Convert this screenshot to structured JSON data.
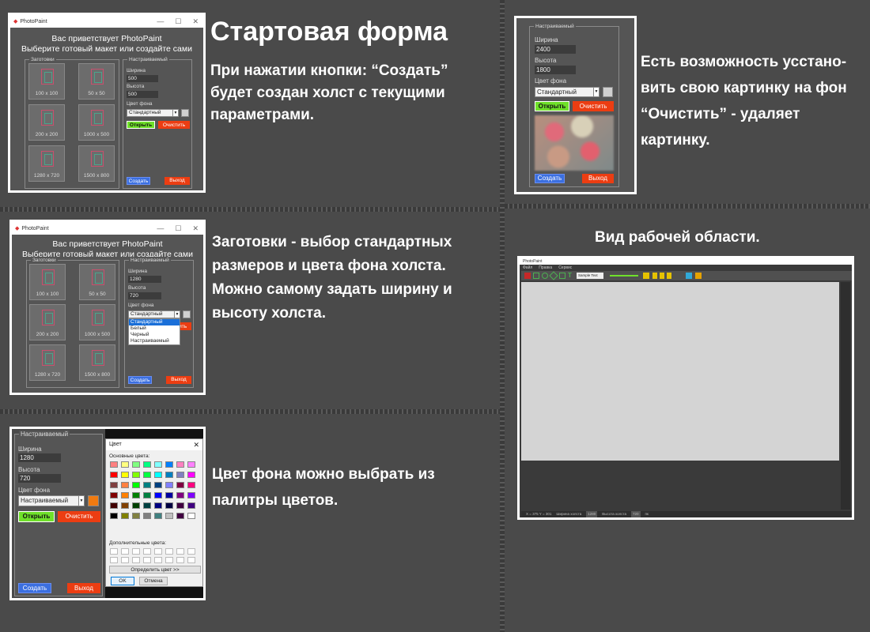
{
  "separators": true,
  "captions": {
    "start_title": "Стартовая форма",
    "start_text": [
      "При нажатии кнопки: “Создать”",
      "будет создан холст с текущими",
      "параметрами."
    ],
    "image_text": [
      "Есть возможность усстано-",
      "вить свою картинку на фон",
      "“Очистить” -  удаляет",
      "картинку."
    ],
    "presets_text": [
      "Заготовки - выбор стандартных",
      "размеров и цвета фона холста.",
      "Можно самому задать ширину и",
      "высоту холста."
    ],
    "workspace_title": "Вид рабочей области.",
    "palette_text": [
      "Цвет фона можно выбрать из",
      "палитры цветов."
    ]
  },
  "app": {
    "name": "PhotoPaint",
    "welcome_1": "Вас приветствует PhotoPaint",
    "welcome_2": "Выберите готовый макет или создайте сами",
    "presets_legend": "Заготовки",
    "custom_legend": "Настраиваемый",
    "width_label": "Ширина",
    "height_label": "Высота",
    "bg_label": "Цвет фона",
    "open_btn": "Открыть",
    "clear_btn": "Очистить",
    "create_btn": "Создать",
    "exit_btn": "Выход",
    "presets": [
      "100 x 100",
      "50 x 50",
      "200 x 200",
      "1000 x 500",
      "1280 x 720",
      "1500 x 800"
    ]
  },
  "shot1": {
    "width": "500",
    "height": "500",
    "bg": "Стандартный"
  },
  "shot2": {
    "width": "1280",
    "height": "720",
    "bg": "Стандартный",
    "dropdown": [
      "Стандартный",
      "Белый",
      "Черный",
      "Настраиваемый"
    ]
  },
  "shot3": {
    "width": "2400",
    "height": "1800",
    "bg": "Стандартный"
  },
  "shot4": {
    "width": "1280",
    "height": "720",
    "bg": "Настраиваемый",
    "swatch": "#f07a10",
    "dialog_title": "Цвет",
    "basic_colors": "Основные цвета:",
    "custom_colors": "Дополнительные цвета:",
    "define_btn": "Определить цвет >>",
    "ok_btn": "OK",
    "cancel_btn": "Отмена",
    "palette": [
      "#ff8080",
      "#ffff80",
      "#80ff80",
      "#00ff80",
      "#80ffff",
      "#0080ff",
      "#ff80c0",
      "#ff80ff",
      "#ff0000",
      "#ffff00",
      "#80ff00",
      "#00ff40",
      "#00ffff",
      "#0080c0",
      "#8080c0",
      "#ff00ff",
      "#804040",
      "#ff8040",
      "#00ff00",
      "#008080",
      "#004080",
      "#8080ff",
      "#800040",
      "#ff0080",
      "#800000",
      "#ff8000",
      "#008000",
      "#008040",
      "#0000ff",
      "#0000a0",
      "#800080",
      "#8000ff",
      "#400000",
      "#804000",
      "#004000",
      "#004040",
      "#000080",
      "#000040",
      "#400040",
      "#400080",
      "#000000",
      "#808000",
      "#808040",
      "#808080",
      "#408080",
      "#c0c0c0",
      "#400040",
      "#ffffff"
    ]
  },
  "workspace": {
    "menu": [
      "Файл",
      "Правка",
      "Сервис"
    ],
    "toolbar_field": "Sample Text",
    "status": [
      "X = 375  Y = 301",
      "Ширина холста",
      "1280",
      "Высота холста",
      "720",
      "пк"
    ]
  }
}
